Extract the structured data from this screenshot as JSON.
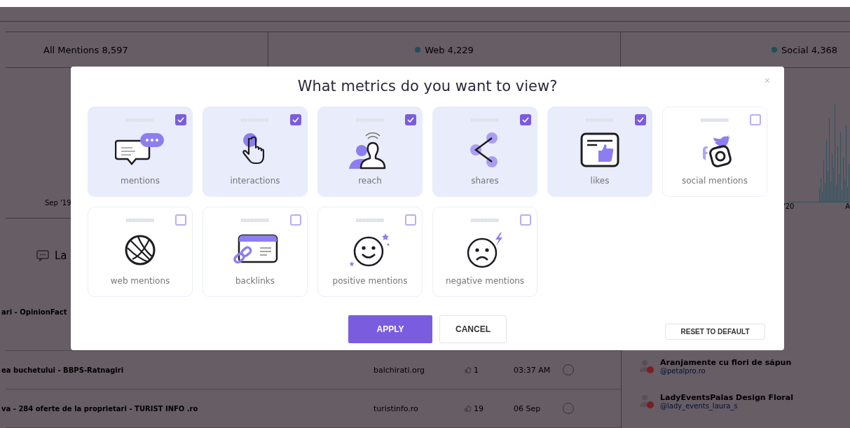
{
  "stats": [
    {
      "label": "All Mentions 8,597"
    },
    {
      "label": "Web 4,229",
      "color": "#1f4f5a"
    },
    {
      "label": "Social 4,368",
      "color": "#1f4f5a"
    }
  ],
  "chart": {
    "left_label": "Sep '19",
    "right_label": "'20",
    "edge_label": "A"
  },
  "section": {
    "title": "La"
  },
  "rows": [
    {
      "title": "ari - OpinionFact"
    },
    {
      "title": "ea buchetului - BBPS-Ratnagiri",
      "site": "balchirati.org",
      "count": "1",
      "time": "03:37 AM",
      "checked": false
    },
    {
      "title": "va - 284 oferte de la proprietari - TURIST INFO .ro",
      "site": "turistinfo.ro",
      "count": "19",
      "time": "06 Sep",
      "checked": false
    }
  ],
  "authors": [
    {
      "name": "Aranjamente cu flori de săpun",
      "handle": "@petalpro.ro"
    },
    {
      "name": "LadyEventsPalas Design Floral",
      "handle": "@lady_events_laura_s"
    }
  ],
  "dialog": {
    "title": "What metrics do you want to view?",
    "close": "×",
    "metrics": [
      {
        "kind": "mentions",
        "label": "mentions",
        "checked": true
      },
      {
        "kind": "interactions",
        "label": "interactions",
        "checked": true
      },
      {
        "kind": "reach",
        "label": "reach",
        "checked": true
      },
      {
        "kind": "shares",
        "label": "shares",
        "checked": true
      },
      {
        "kind": "likes",
        "label": "likes",
        "checked": true
      },
      {
        "kind": "social",
        "label": "social mentions",
        "checked": false
      },
      {
        "kind": "web",
        "label": "web mentions",
        "checked": false
      },
      {
        "kind": "backlinks",
        "label": "backlinks",
        "checked": false
      },
      {
        "kind": "positive",
        "label": "positive mentions",
        "checked": false
      },
      {
        "kind": "negative",
        "label": "negative mentions",
        "checked": false
      }
    ],
    "apply": "APPLY",
    "cancel": "CANCEL",
    "reset": "RESET TO DEFAULT"
  }
}
